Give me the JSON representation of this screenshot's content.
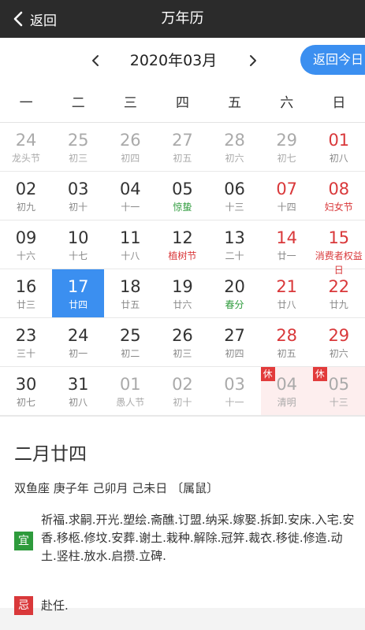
{
  "header": {
    "back_label": "返回",
    "title": "万年历"
  },
  "month_nav": {
    "label": "2020年03月",
    "today_button": "返回今日"
  },
  "weekdays": [
    "一",
    "二",
    "三",
    "四",
    "五",
    "六",
    "日"
  ],
  "calendar": {
    "rows": [
      [
        {
          "day": "24",
          "sub": "龙头节",
          "state": "other"
        },
        {
          "day": "25",
          "sub": "初三",
          "state": "other"
        },
        {
          "day": "26",
          "sub": "初四",
          "state": "other"
        },
        {
          "day": "27",
          "sub": "初五",
          "state": "other"
        },
        {
          "day": "28",
          "sub": "初六",
          "state": "other"
        },
        {
          "day": "29",
          "sub": "初七",
          "state": "other"
        },
        {
          "day": "01",
          "sub": "初八",
          "state": "weekend"
        }
      ],
      [
        {
          "day": "02",
          "sub": "初九"
        },
        {
          "day": "03",
          "sub": "初十"
        },
        {
          "day": "04",
          "sub": "十一"
        },
        {
          "day": "05",
          "sub": "惊蛰",
          "subColor": "green"
        },
        {
          "day": "06",
          "sub": "十三"
        },
        {
          "day": "07",
          "sub": "十四",
          "state": "weekend"
        },
        {
          "day": "08",
          "sub": "妇女节",
          "state": "weekend",
          "subColor": "red"
        }
      ],
      [
        {
          "day": "09",
          "sub": "十六"
        },
        {
          "day": "10",
          "sub": "十七"
        },
        {
          "day": "11",
          "sub": "十八"
        },
        {
          "day": "12",
          "sub": "植树节",
          "subColor": "red"
        },
        {
          "day": "13",
          "sub": "二十"
        },
        {
          "day": "14",
          "sub": "廿一",
          "state": "weekend"
        },
        {
          "day": "15",
          "sub": "消费者权益日",
          "state": "weekend",
          "subColor": "red",
          "multi": true
        }
      ],
      [
        {
          "day": "16",
          "sub": "廿三"
        },
        {
          "day": "17",
          "sub": "廿四",
          "state": "selected"
        },
        {
          "day": "18",
          "sub": "廿五"
        },
        {
          "day": "19",
          "sub": "廿六"
        },
        {
          "day": "20",
          "sub": "春分",
          "subColor": "green"
        },
        {
          "day": "21",
          "sub": "廿八",
          "state": "weekend"
        },
        {
          "day": "22",
          "sub": "廿九",
          "state": "weekend"
        }
      ],
      [
        {
          "day": "23",
          "sub": "三十"
        },
        {
          "day": "24",
          "sub": "初一"
        },
        {
          "day": "25",
          "sub": "初二"
        },
        {
          "day": "26",
          "sub": "初三"
        },
        {
          "day": "27",
          "sub": "初四"
        },
        {
          "day": "28",
          "sub": "初五",
          "state": "weekend"
        },
        {
          "day": "29",
          "sub": "初六",
          "state": "weekend"
        }
      ],
      [
        {
          "day": "30",
          "sub": "初七"
        },
        {
          "day": "31",
          "sub": "初八"
        },
        {
          "day": "01",
          "sub": "愚人节",
          "state": "other"
        },
        {
          "day": "02",
          "sub": "初十",
          "state": "other"
        },
        {
          "day": "03",
          "sub": "十一",
          "state": "other"
        },
        {
          "day": "04",
          "sub": "清明",
          "state": "holiday",
          "badge": "休"
        },
        {
          "day": "05",
          "sub": "十三",
          "state": "holiday",
          "badge": "休"
        }
      ]
    ]
  },
  "detail": {
    "lunar_date": "二月廿四",
    "zodiac_line": "双鱼座 庚子年 己卯月 己未日 〔属鼠〕",
    "yi_label": "宜",
    "yi_text": "祈福.求嗣.开光.塑绘.斋醮.订盟.纳采.嫁娶.拆卸.安床.入宅.安香.移柩.修坟.安葬.谢土.栽种.解除.冠笄.裁衣.移徙.修造.动土.竖柱.放水.启攒.立碑.",
    "ji_label": "忌",
    "ji_text": "赴任."
  },
  "colors": {
    "accent": "#3b8ff0",
    "red": "#d9383a",
    "green": "#2e9b3c",
    "topbar": "#2b2b2b"
  }
}
